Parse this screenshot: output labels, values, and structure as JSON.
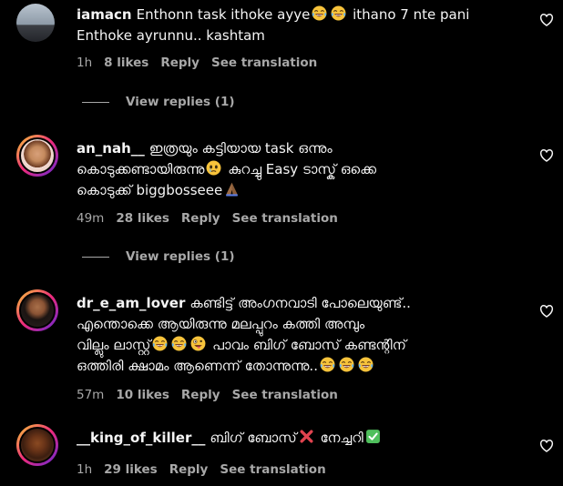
{
  "colors": {
    "background": "#000000",
    "text": "#f5f5f5",
    "secondary": "#a8a8a8"
  },
  "comments": [
    {
      "username": "iamacn",
      "text_1": "Enthonn task ithoke ayye",
      "text_2": "ithano 7 nte pani",
      "text_3": "Enthoke ayrunnu.. kashtam",
      "time": "1h",
      "likes": "8 likes",
      "reply": "Reply",
      "translate": "See translation",
      "view_replies": "View replies (1)"
    },
    {
      "username": "an_nah__",
      "text_1": "ഇത്രയും കട്ടിയായ task ഒന്നും",
      "text_2": "കൊടുക്കണ്ടായിരുന്നു",
      "text_3": "കുറച്ചു Easy ടാസ്ക് ഒക്കെ",
      "text_4": "കൊടുക്ക് biggbosseee",
      "time": "49m",
      "likes": "28 likes",
      "reply": "Reply",
      "translate": "See translation",
      "view_replies": "View replies (1)"
    },
    {
      "username": "dr_e_am_lover",
      "text_1": "കണ്ടിട്ട് അംഗനവാടി പോലെയുണ്ട്..",
      "text_2": "എന്തൊക്കെ ആയിരുന്നു മലപ്പുറം കത്തി അമ്പും",
      "text_3": "വില്ലും ലാസ്റ്റ്",
      "text_4": "പാവം ബിഗ് ബോസ് കണ്ടന്റിന്",
      "text_5": "ഒത്തിരി ക്ഷാമം ആണെന്ന് തോന്നുന്നു..",
      "time": "57m",
      "likes": "10 likes",
      "reply": "Reply",
      "translate": "See translation"
    },
    {
      "username": "__king_of_killer__",
      "text_1": "ബിഗ് ബോസ്",
      "text_2": "നേച്ചറി",
      "time": "1h",
      "likes": "29 likes",
      "reply": "Reply",
      "translate": "See translation"
    }
  ]
}
